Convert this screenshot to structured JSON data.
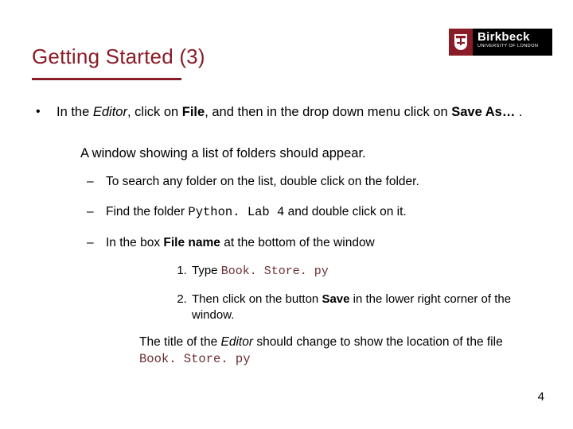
{
  "logo": {
    "big": "Birkbeck",
    "small": "UNIVERSITY OF LONDON"
  },
  "title": {
    "text": "Getting Started",
    "num": "(3)"
  },
  "bullet1": {
    "seg1": "In the ",
    "editor": "Editor",
    "seg2": ", click on ",
    "file": "File",
    "seg3": ", and then in the drop down menu click on ",
    "saveas": "Save As…",
    "seg4": " ."
  },
  "lead2": "A window showing a list of folders should appear.",
  "dash1": "To search any folder on the list, double click on the folder.",
  "dash2": {
    "a": "Find the folder  ",
    "folder": "Python. Lab 4",
    "b": "  and double click on it."
  },
  "dash3": {
    "a": "In the box ",
    "filename_label": "File name",
    "b": " at the bottom of the window"
  },
  "step1": {
    "a": "Type ",
    "fname": "Book. Store. py"
  },
  "step2": {
    "a": "Then click on the button ",
    "save": "Save",
    "b": " in the lower right corner of the window."
  },
  "trailer": {
    "a": "The title of the ",
    "editor": "Editor",
    "b": "  should change to show the location of the file ",
    "fname": "Book. Store. py"
  },
  "page": "4"
}
